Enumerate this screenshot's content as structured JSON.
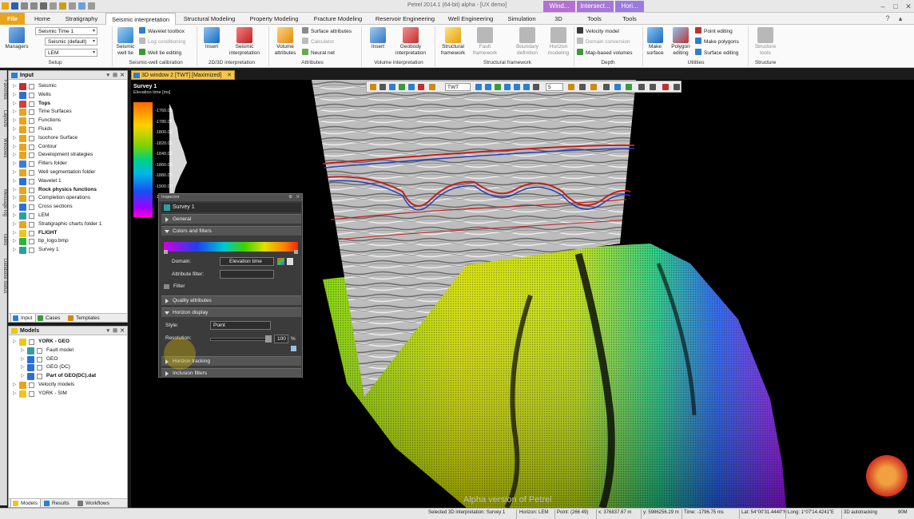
{
  "app": {
    "title": "Petrel 2014.1 (64-bit) alpha - [UX demo]",
    "context_tabs": [
      "Wind...",
      "Intersect...",
      "Hori..."
    ]
  },
  "menu": {
    "tabs": [
      "File",
      "Home",
      "Stratigraphy",
      "Seismic interpretation",
      "Structural Modeling",
      "Property Modeling",
      "Fracture Modeling",
      "Reservoir Engineering",
      "Well Engineering",
      "Simulation",
      "3D",
      "Tools",
      "Tools"
    ],
    "active": "Seismic interpretation"
  },
  "ribbon": {
    "managers": "Managers",
    "seismic_combo": "Seismic Time 1",
    "seismic_default": "Seismic (default)",
    "lem_combo": "LEM",
    "setup": "Setup",
    "seismic_well_tie": "Seismic well tie",
    "wavelet_toolbox": "Wavelet toolbox",
    "log_conditioning": "Log conditioning",
    "well_tie_editing": "Well tie editing",
    "swc_group": "Seismic-well calibration",
    "insert": "Insert",
    "seismic_interpretation": "Seismic interpretation",
    "interp_group": "2D/3D interpretation",
    "volume_attributes": "Volume attributes",
    "surface_attributes": "Surface attributes",
    "calculator": "Calculator",
    "neural_net": "Neural net",
    "attr_group": "Attributes",
    "insert2": "Insert",
    "geobody": "Geobody interpretation",
    "vol_interp_group": "Volume interpretation",
    "structural_framework": "Structural framework",
    "fault_framework": "Fault framework",
    "boundary_definition": "Boundary definition",
    "horizon_modeling": "Horizon modeling",
    "sf_group": "Structural framework",
    "velocity_model": "Velocity model",
    "domain_conversion": "Domain conversion",
    "map_based_volumes": "Map-based volumes",
    "depth_group": "Depth",
    "make_surface": "Make surface",
    "polygon_editing": "Polygon editing",
    "point_editing": "Point editing",
    "make_polygons": "Make polygons",
    "surface_editing": "Surface editing",
    "util_group": "Utilities",
    "structure_tools": "Structure tools",
    "structure_group": "Structure"
  },
  "side_tabs": [
    "Favorites",
    "Layouts",
    "Windows",
    "Message log",
    "Tasks",
    "Database status"
  ],
  "input_panel": {
    "title": "Input",
    "items": [
      {
        "label": "Seismic",
        "bold": false,
        "color": "#c03030"
      },
      {
        "label": "Wells",
        "bold": false,
        "color": "#2a6fd6"
      },
      {
        "label": "Tops",
        "bold": true,
        "color": "#d04040"
      },
      {
        "label": "Time Surfaces",
        "bold": false,
        "color": "#e8a41a"
      },
      {
        "label": "Functions",
        "bold": false,
        "color": "#e8a41a"
      },
      {
        "label": "Fluids",
        "bold": false,
        "color": "#e8a41a"
      },
      {
        "label": "Isochore Surface",
        "bold": false,
        "color": "#e8a41a"
      },
      {
        "label": "Contour",
        "bold": false,
        "color": "#e8a41a"
      },
      {
        "label": "Development strategies",
        "bold": false,
        "color": "#e8a41a"
      },
      {
        "label": "Filters folder",
        "bold": false,
        "color": "#3a7de0"
      },
      {
        "label": "Well segmentation folder",
        "bold": false,
        "color": "#e8a41a"
      },
      {
        "label": "Wavelet 1",
        "bold": false,
        "color": "#2a6fd6"
      },
      {
        "label": "Rock physics functions",
        "bold": true,
        "color": "#e8a41a"
      },
      {
        "label": "Completion operations",
        "bold": false,
        "color": "#e8a41a"
      },
      {
        "label": "Cross sections",
        "bold": false,
        "color": "#2a6fd6"
      },
      {
        "label": "LEM",
        "bold": false,
        "color": "#2ba0a0"
      },
      {
        "label": "Stratigraphic charts folder 1",
        "bold": false,
        "color": "#e8a41a"
      },
      {
        "label": "FLIGHT",
        "bold": true,
        "color": "#e8c81a"
      },
      {
        "label": "bp_logo.bmp",
        "bold": false,
        "color": "#30b040"
      },
      {
        "label": "Survey 1",
        "bold": false,
        "color": "#2ba0a0"
      }
    ],
    "footer_tabs": [
      "Input",
      "Cases",
      "Templates"
    ]
  },
  "models_panel": {
    "title": "Models",
    "items": [
      {
        "label": "YORK - GEO",
        "bold": true,
        "indent": 0,
        "color": "#e8c81a"
      },
      {
        "label": "Fault model",
        "bold": false,
        "indent": 1,
        "color": "#2ba0a0"
      },
      {
        "label": "GEO",
        "bold": false,
        "indent": 1,
        "color": "#2a6fd6"
      },
      {
        "label": "GEO (DC)",
        "bold": false,
        "indent": 1,
        "color": "#2a6fd6"
      },
      {
        "label": "Part of GEO(DC).dat",
        "bold": true,
        "indent": 1,
        "color": "#2a6fd6"
      },
      {
        "label": "Velocity models",
        "bold": false,
        "indent": 0,
        "color": "#e8a41a"
      },
      {
        "label": "YORK - SIM",
        "bold": false,
        "indent": 0,
        "color": "#e8c81a"
      }
    ],
    "footer_tabs": [
      "Models",
      "Results",
      "Workflows"
    ]
  },
  "window": {
    "tab_title": "3D window 2 [TWT] [Maximized]",
    "survey_label": "Survey 1",
    "survey_sub": "Elevation time [ms]",
    "colorbar_ticks": [
      "-1760.00",
      "-1780.00",
      "-1800.00",
      "-1820.00",
      "-1840.00",
      "-1860.00",
      "-1880.00",
      "-1900.00",
      "-1920.00"
    ],
    "watermark": "Alpha version of Petrel",
    "toolbar_domain": "TWT",
    "toolbar_num": "5"
  },
  "inspector": {
    "title": "Inspector",
    "object": "Survey 1",
    "general": "General",
    "colors_filters": "Colors and filters",
    "domain_label": "Domain:",
    "domain_value": "Elevation time",
    "attribute_filter_label": "Attribute filter:",
    "filter": "Filter",
    "quality_attributes": "Quality attributes",
    "horizon_display": "Horizon display",
    "style_label": "Style:",
    "style_value": "Point",
    "resolution_label": "Resolution:",
    "resolution_value": "100",
    "resolution_unit": "%",
    "horizon_tracking": "Horizon tracking",
    "inclusion_filters": "Inclusion filters"
  },
  "status": {
    "selected": "Selected 3D interpretation: Survey 1",
    "horizon": "Horizon: LEM",
    "point": "Point: (266 49)",
    "x": "x: 376837.67 m",
    "y": "y: 5986256.29 m",
    "time": "Time: -1796.75 ms",
    "lat": "Lat: 54°00'31.4440\"N",
    "long": "Long: 1°07'14.4241\"E",
    "mode": "3D autotracking",
    "zoom": "90M"
  }
}
